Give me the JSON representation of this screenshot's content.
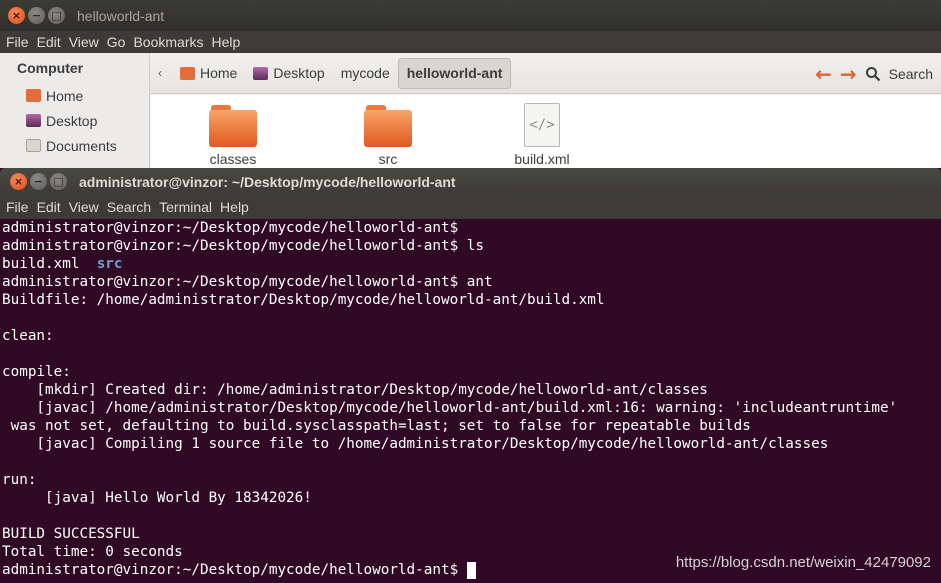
{
  "file_manager": {
    "title": "helloworld-ant",
    "menu": [
      "File",
      "Edit",
      "View",
      "Go",
      "Bookmarks",
      "Help"
    ],
    "sidebar": {
      "section": "Computer",
      "items": [
        {
          "label": "Home",
          "icon": "home-icon"
        },
        {
          "label": "Desktop",
          "icon": "desktop-icon"
        },
        {
          "label": "Documents",
          "icon": "documents-icon"
        }
      ]
    },
    "breadcrumbs": [
      {
        "label": "Home",
        "icon": "home-icon"
      },
      {
        "label": "Desktop",
        "icon": "desktop-icon"
      },
      {
        "label": "mycode"
      },
      {
        "label": "helloworld-ant",
        "active": true
      }
    ],
    "search_label": "Search",
    "files": [
      {
        "name": "classes",
        "type": "folder"
      },
      {
        "name": "src",
        "type": "folder"
      },
      {
        "name": "build.xml",
        "type": "xml"
      }
    ],
    "colors": {
      "accent": "#e26d3a",
      "folder": "#f39a5a"
    }
  },
  "terminal": {
    "title": "administrator@vinzor: ~/Desktop/mycode/helloworld-ant",
    "menu": [
      "File",
      "Edit",
      "View",
      "Search",
      "Terminal",
      "Help"
    ],
    "lines": [
      "administrator@vinzor:~/Desktop/mycode/helloworld-ant$",
      "administrator@vinzor:~/Desktop/mycode/helloworld-ant$ ls",
      "",
      "administrator@vinzor:~/Desktop/mycode/helloworld-ant$ ant",
      "Buildfile: /home/administrator/Desktop/mycode/helloworld-ant/build.xml",
      "",
      "clean:",
      "",
      "compile:",
      "    [mkdir] Created dir: /home/administrator/Desktop/mycode/helloworld-ant/classes",
      "    [javac] /home/administrator/Desktop/mycode/helloworld-ant/build.xml:16: warning: 'includeantruntime'",
      " was not set, defaulting to build.sysclasspath=last; set to false for repeatable builds",
      "    [javac] Compiling 1 source file to /home/administrator/Desktop/mycode/helloworld-ant/classes",
      "",
      "run:",
      "     [java] Hello World By 18342026!",
      "",
      "BUILD SUCCESSFUL",
      "Total time: 0 seconds",
      "administrator@vinzor:~/Desktop/mycode/helloworld-ant$ "
    ],
    "ls_output": {
      "file": "build.xml",
      "dir": "src"
    },
    "colors": {
      "background": "#300a24",
      "foreground": "#ffffff",
      "directory": "#729fcf"
    }
  },
  "watermark": "https://blog.csdn.net/weixin_42479092"
}
